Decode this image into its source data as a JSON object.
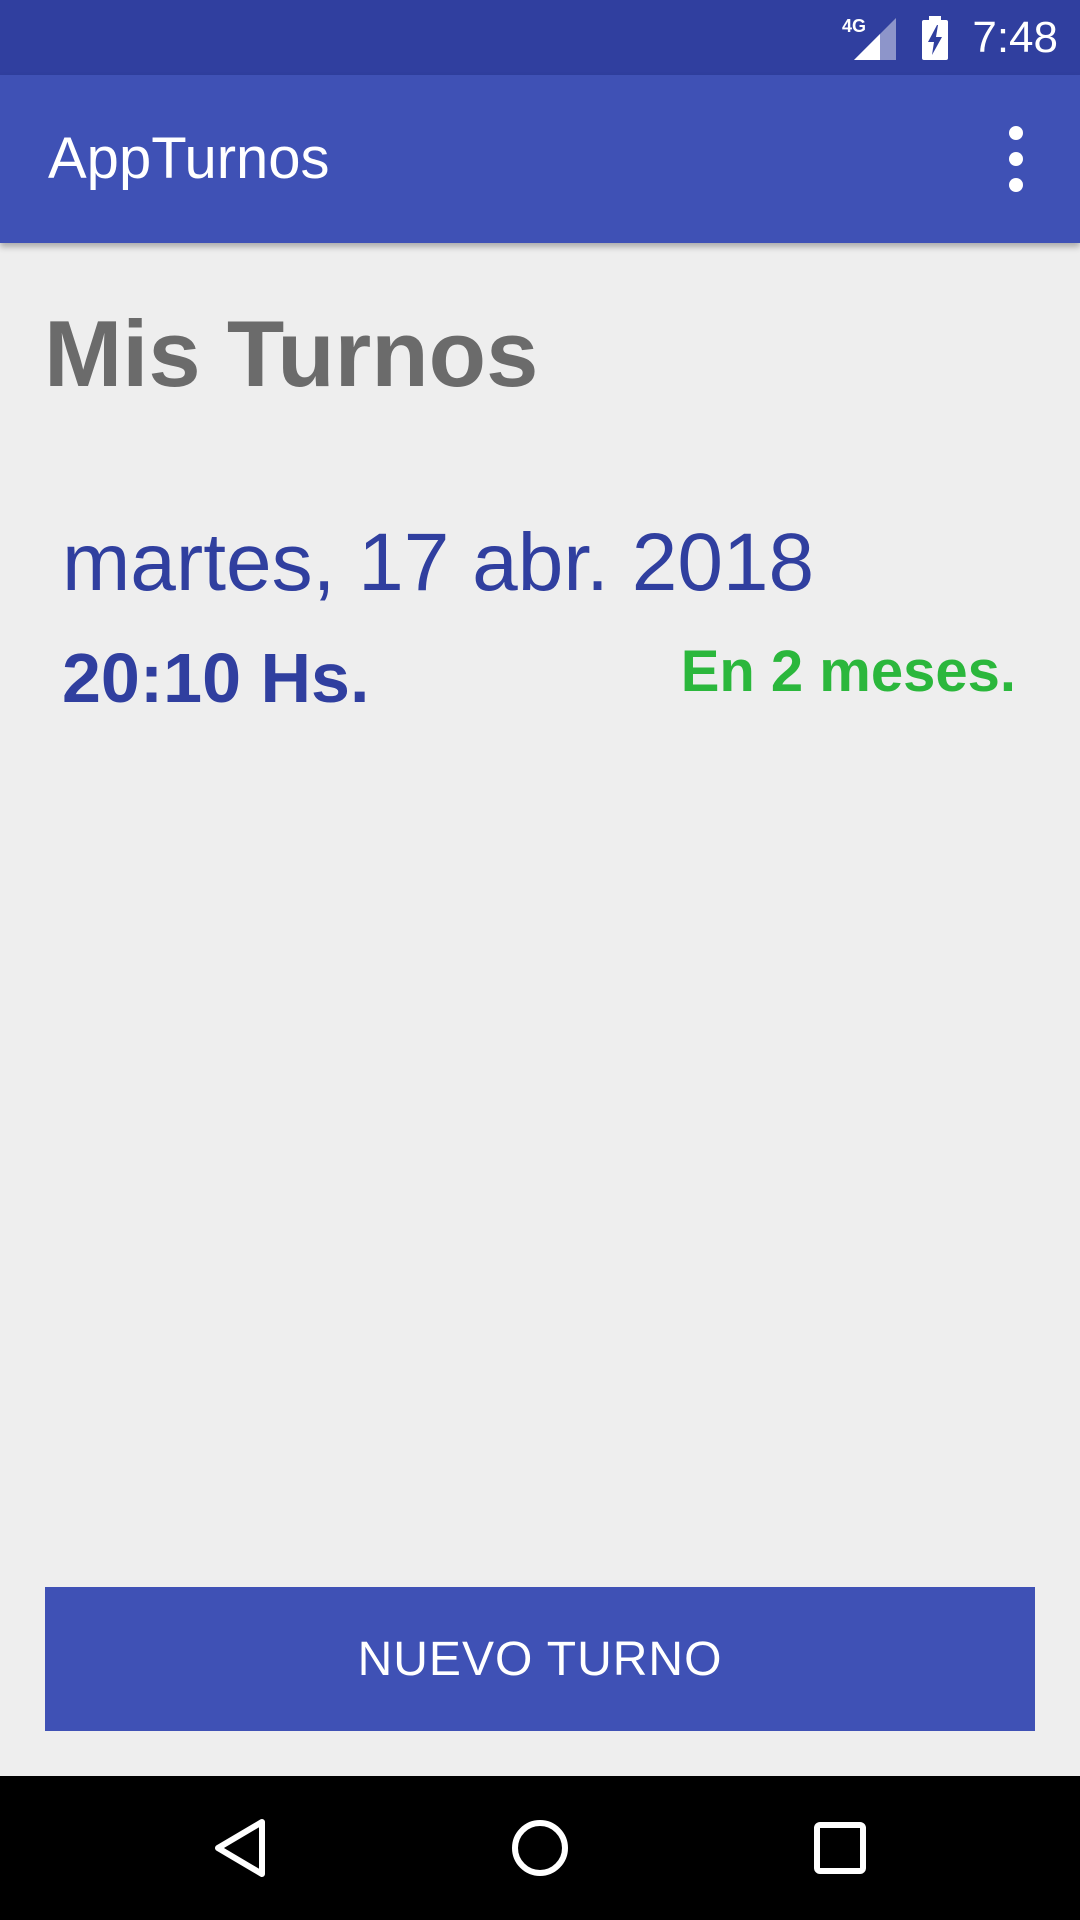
{
  "status_bar": {
    "network": "4G",
    "time": "7:48",
    "icons": [
      "signal-icon",
      "battery-charging-icon"
    ]
  },
  "app_bar": {
    "title": "AppTurnos",
    "overflow_icon": "more-vert-icon"
  },
  "main": {
    "page_title": "Mis Turnos",
    "turnos": [
      {
        "date": "martes, 17 abr. 2018",
        "time": "20:10 Hs.",
        "relative": "En 2 meses."
      }
    ]
  },
  "actions": {
    "new_turno_label": "NUEVO TURNO"
  },
  "nav_bar": {
    "icons": [
      "back-icon",
      "home-icon",
      "recents-icon"
    ]
  },
  "colors": {
    "primary": "#3f51b5",
    "primary_dark": "#303f9f",
    "accent_green": "#2bb73c",
    "background": "#eeeeee"
  }
}
